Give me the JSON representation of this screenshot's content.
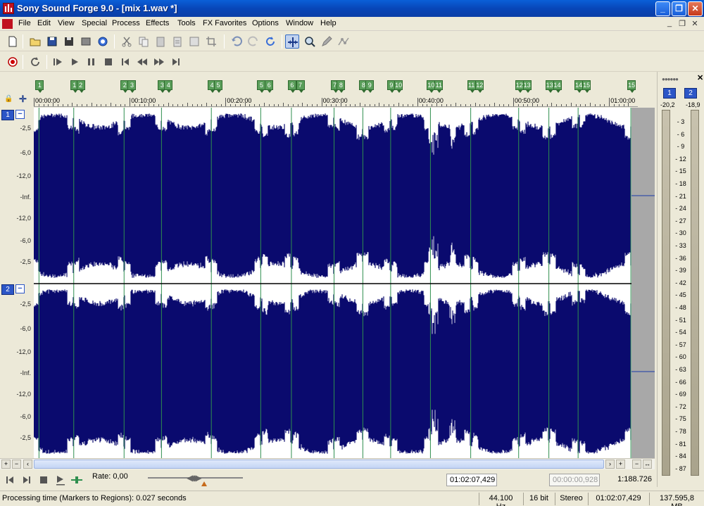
{
  "window": {
    "title": "Sony Sound Forge 9.0 - [mix 1.wav *]"
  },
  "menu": [
    "File",
    "Edit",
    "View",
    "Special",
    "Process",
    "Effects",
    "Tools",
    "FX Favorites",
    "Options",
    "Window",
    "Help"
  ],
  "icons": {
    "toolbar": [
      "new-file-icon",
      "open-icon",
      "save-icon",
      "save-as-icon",
      "render-icon",
      "web-icon",
      "cut-icon",
      "copy-icon",
      "paste-icon",
      "paste-special-icon",
      "mix-icon",
      "crop-icon",
      "undo-icon",
      "redo-icon",
      "repeat-icon",
      "edit-tool-icon",
      "magnify-tool-icon",
      "pencil-tool-icon",
      "envelope-tool-icon"
    ],
    "transport": [
      "record-icon",
      "loop-icon",
      "play-all-icon",
      "play-icon",
      "pause-icon",
      "stop-icon",
      "go-to-start-icon",
      "rewind-icon",
      "forward-icon",
      "go-to-end-icon"
    ]
  },
  "markers": [
    {
      "label": "1",
      "t": 0.35
    },
    {
      "label": "1",
      "t": 7.6
    },
    {
      "label": "2",
      "t": 8.9
    },
    {
      "label": "2",
      "t": 18.1
    },
    {
      "label": "3",
      "t": 19.6
    },
    {
      "label": "3",
      "t": 25.9
    },
    {
      "label": "4",
      "t": 27.2
    },
    {
      "label": "4",
      "t": 36.3
    },
    {
      "label": "5",
      "t": 37.6
    },
    {
      "label": "5",
      "t": 46.6
    },
    {
      "label": "6",
      "t": 48.2
    },
    {
      "label": "6",
      "t": 53.0
    },
    {
      "label": "7",
      "t": 54.7
    },
    {
      "label": "7",
      "t": 61.9
    },
    {
      "label": "8",
      "t": 63.2
    },
    {
      "label": "8",
      "t": 67.9
    },
    {
      "label": "9",
      "t": 69.2
    },
    {
      "label": "9",
      "t": 73.7
    },
    {
      "label": "10",
      "t": 75.2
    },
    {
      "label": "10",
      "t": 82.0
    },
    {
      "label": "11",
      "t": 83.6
    },
    {
      "label": "11",
      "t": 90.4
    },
    {
      "label": "12",
      "t": 92.1
    },
    {
      "label": "12",
      "t": 100.4
    },
    {
      "label": "13",
      "t": 102.0
    },
    {
      "label": "13",
      "t": 106.7
    },
    {
      "label": "14",
      "t": 108.3
    },
    {
      "label": "14",
      "t": 112.8
    },
    {
      "label": "15",
      "t": 114.4
    },
    {
      "label": "15",
      "t": 123.8
    }
  ],
  "ruler": {
    "labels": [
      {
        "text": "00:00:00",
        "t": 0
      },
      {
        "text": "00:10:00",
        "t": 20
      },
      {
        "text": "00:20:00",
        "t": 40
      },
      {
        "text": "00:30:00",
        "t": 60
      },
      {
        "text": "00:40:00",
        "t": 80
      },
      {
        "text": "00:50:00",
        "t": 100
      },
      {
        "text": "01:00:00",
        "t": 120
      }
    ]
  },
  "channels": [
    {
      "id": "1",
      "db_labels": [
        "-2,5",
        "-6,0",
        "-12,0",
        "-Inf.",
        "-12,0",
        "-6,0",
        "-2,5"
      ]
    },
    {
      "id": "2",
      "db_labels": [
        "-2,5",
        "-6,0",
        "-12,0",
        "-Inf.",
        "-12,0",
        "-6,0",
        "-2,5"
      ]
    }
  ],
  "waveform": {
    "color": "#0a0a6e",
    "region_line_color": "#2f8f4f"
  },
  "bottom": {
    "rate_label": "Rate: 0,00",
    "position": "01:02:07,429",
    "selection_length": "00:00:00,928",
    "zoom": "1:188.726"
  },
  "meter": {
    "channels": [
      "1",
      "2"
    ],
    "peaks": [
      "-20,2",
      "-18,9"
    ],
    "scale": [
      "3",
      "6",
      "9",
      "12",
      "15",
      "18",
      "21",
      "24",
      "27",
      "30",
      "33",
      "36",
      "39",
      "42",
      "45",
      "48",
      "51",
      "54",
      "57",
      "60",
      "63",
      "66",
      "69",
      "72",
      "75",
      "78",
      "81",
      "84",
      "87"
    ]
  },
  "status": {
    "message": "Processing time (Markers to Regions): 0.027 seconds",
    "sample_rate": "44.100 Hz",
    "bit_depth": "16 bit",
    "channels": "Stereo",
    "length": "01:02:07,429",
    "disk_space": "137.595,8 MB"
  }
}
